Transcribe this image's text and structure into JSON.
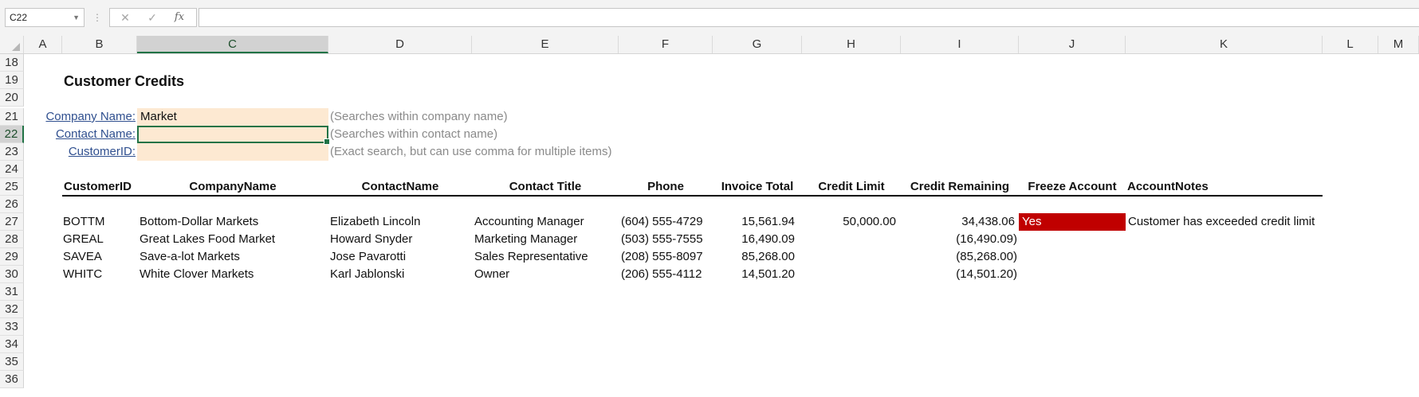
{
  "formula_bar": {
    "name_box": "C22",
    "separator": "⋮",
    "cancel_icon": "✕",
    "enter_icon": "✓",
    "function_label": "fx",
    "formula": ""
  },
  "columns": [
    "A",
    "B",
    "C",
    "D",
    "E",
    "F",
    "G",
    "H",
    "I",
    "J",
    "K",
    "L",
    "M"
  ],
  "selected_column": "C",
  "rows": [
    "18",
    "19",
    "20",
    "21",
    "22",
    "23",
    "24",
    "25",
    "26",
    "27",
    "28",
    "29",
    "30",
    "31",
    "32",
    "33",
    "34",
    "35",
    "36"
  ],
  "selected_row": "22",
  "sheet": {
    "title": "Customer Credits",
    "search": [
      {
        "label": "Company Name:",
        "value": "Market",
        "hint": "(Searches within company name)"
      },
      {
        "label": "Contact Name:",
        "value": "",
        "hint": "(Searches within contact name)"
      },
      {
        "label": "CustomerID:",
        "value": "",
        "hint": "(Exact search, but can use comma for multiple items)"
      }
    ],
    "headers": {
      "customer_id": "CustomerID",
      "company_name": "CompanyName",
      "contact_name": "ContactName",
      "contact_title": "Contact Title",
      "phone": "Phone",
      "invoice_total": "Invoice Total",
      "credit_limit": "Credit Limit",
      "credit_remaining": "Credit Remaining",
      "freeze_account": "Freeze Account",
      "account_notes": "AccountNotes"
    },
    "records": [
      {
        "id": "BOTTM",
        "company": "Bottom-Dollar Markets",
        "contact": "Elizabeth Lincoln",
        "title": "Accounting Manager",
        "phone": "(604) 555-4729",
        "invoice": "15,561.94",
        "limit": "50,000.00",
        "remaining": "34,438.06",
        "freeze": "Yes",
        "notes": "Customer has exceeded credit limit"
      },
      {
        "id": "GREAL",
        "company": "Great Lakes Food Market",
        "contact": "Howard Snyder",
        "title": "Marketing Manager",
        "phone": "(503) 555-7555",
        "invoice": "16,490.09",
        "limit": "",
        "remaining": "(16,490.09)",
        "freeze": "",
        "notes": ""
      },
      {
        "id": "SAVEA",
        "company": "Save-a-lot Markets",
        "contact": "Jose Pavarotti",
        "title": "Sales Representative",
        "phone": "(208) 555-8097",
        "invoice": "85,268.00",
        "limit": "",
        "remaining": "(85,268.00)",
        "freeze": "",
        "notes": ""
      },
      {
        "id": "WHITC",
        "company": "White Clover Markets",
        "contact": "Karl Jablonski",
        "title": "Owner",
        "phone": "(206) 555-4112",
        "invoice": "14,501.20",
        "limit": "",
        "remaining": "(14,501.20)",
        "freeze": "",
        "notes": ""
      }
    ]
  },
  "colors": {
    "accent": "#217346",
    "input_fill": "#fde9d2",
    "freeze_fill": "#c00000",
    "link": "#2f4f8f"
  }
}
